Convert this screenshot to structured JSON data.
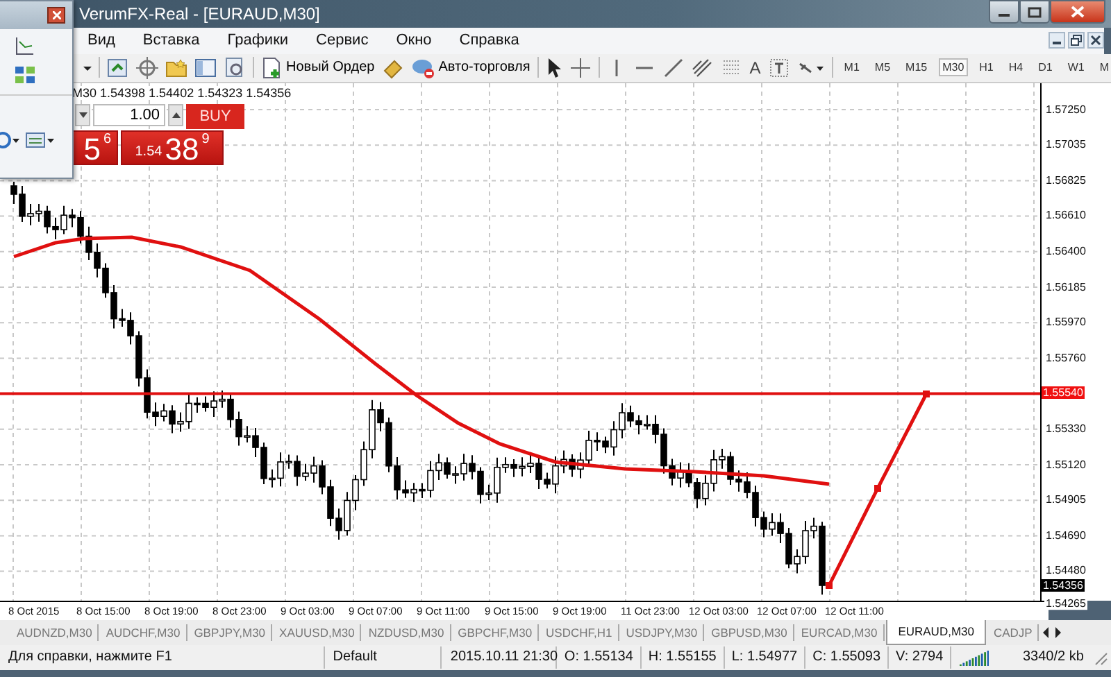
{
  "window": {
    "title": "VerumFX-Real - [EURAUD,M30]"
  },
  "menu": [
    "Вид",
    "Вставка",
    "Графики",
    "Сервис",
    "Окно",
    "Справка"
  ],
  "toolbar": {
    "new_order": "Новый Ордер",
    "autotrading": "Авто-торговля",
    "text_tool": "A",
    "timeframes": [
      {
        "label": "M1",
        "selected": false
      },
      {
        "label": "M5",
        "selected": false
      },
      {
        "label": "M15",
        "selected": false
      },
      {
        "label": "M30",
        "selected": true
      },
      {
        "label": "H1",
        "selected": false
      },
      {
        "label": "H4",
        "selected": false
      },
      {
        "label": "D1",
        "selected": false
      },
      {
        "label": "W1",
        "selected": false
      },
      {
        "label": "M",
        "selected": false
      }
    ]
  },
  "chart": {
    "info": "M30 1.54398 1.54402 1.54323 1.54356",
    "trade_panel": {
      "volume": "1.00",
      "buy_label": "BUY",
      "sell_big": "5",
      "sell_sup": "6",
      "buy_small": "1.54",
      "buy_big": "38",
      "buy_sup": "9"
    },
    "price_labels": [
      {
        "text": "1.57250",
        "marked": false
      },
      {
        "text": "1.57035",
        "marked": false
      },
      {
        "text": "1.56825",
        "marked": false
      },
      {
        "text": "1.56610",
        "marked": false
      },
      {
        "text": "1.56400",
        "marked": false
      },
      {
        "text": "1.56185",
        "marked": false
      },
      {
        "text": "1.55970",
        "marked": false
      },
      {
        "text": "1.55760",
        "marked": false
      },
      {
        "text": "1.55540",
        "marked": true
      },
      {
        "text": "1.55330",
        "marked": false
      },
      {
        "text": "1.55120",
        "marked": false
      },
      {
        "text": "1.54905",
        "marked": false
      },
      {
        "text": "1.54690",
        "marked": false
      },
      {
        "text": "1.54480",
        "marked": false
      }
    ],
    "current_price": "1.54356",
    "bottom_price": "1.54265",
    "time_labels": [
      "8 Oct 2015",
      "8 Oct 15:00",
      "8 Oct 19:00",
      "8 Oct 23:00",
      "9 Oct 03:00",
      "9 Oct 07:00",
      "9 Oct 11:00",
      "9 Oct 15:00",
      "9 Oct 19:00",
      "11 Oct 23:00",
      "12 Oct 03:00",
      "12 Oct 07:00",
      "12 Oct 11:00"
    ]
  },
  "tabs": [
    {
      "label": "AUDNZD,M30",
      "selected": false
    },
    {
      "label": "AUDCHF,M30",
      "selected": false
    },
    {
      "label": "GBPJPY,M30",
      "selected": false
    },
    {
      "label": "XAUUSD,M30",
      "selected": false
    },
    {
      "label": "NZDUSD,M30",
      "selected": false
    },
    {
      "label": "GBPCHF,M30",
      "selected": false
    },
    {
      "label": "USDCHF,H1",
      "selected": false
    },
    {
      "label": "USDJPY,M30",
      "selected": false
    },
    {
      "label": "GBPUSD,M30",
      "selected": false
    },
    {
      "label": "EURCAD,M30",
      "selected": false
    },
    {
      "label": "EURAUD,M30",
      "selected": true
    },
    {
      "label": "CADJP",
      "selected": false
    }
  ],
  "status_bar": {
    "help": "Для справки, нажмите F1",
    "profile": "Default",
    "datetime": "2015.10.11 21:30",
    "ohlcv": [
      "O: 1.55134",
      "H: 1.55155",
      "L: 1.54977",
      "C: 1.55093",
      "V: 2794"
    ],
    "traffic": "3340/2 kb"
  }
}
